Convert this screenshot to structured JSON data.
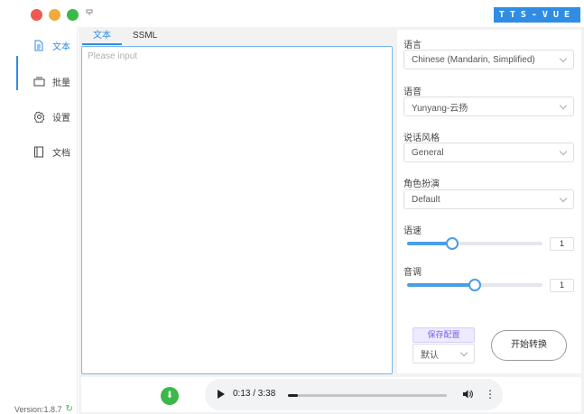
{
  "window": {
    "brand": "TTS-VUE"
  },
  "sidebar": {
    "items": [
      {
        "label": "文本",
        "icon": "document-icon",
        "active": true
      },
      {
        "label": "批量",
        "icon": "stack-icon",
        "active": false
      },
      {
        "label": "设置",
        "icon": "gear-icon",
        "active": false
      },
      {
        "label": "文档",
        "icon": "book-icon",
        "active": false
      }
    ],
    "version": "Version:1.8.7"
  },
  "editor": {
    "tabs": [
      {
        "label": "文本",
        "active": true
      },
      {
        "label": "SSML",
        "active": false
      }
    ],
    "placeholder": "Please input",
    "value": ""
  },
  "settings": {
    "language_label": "语言",
    "language_value": "Chinese (Mandarin, Simplified)",
    "voice_label": "语音",
    "voice_value": "Yunyang-云扬",
    "style_label": "说话风格",
    "style_value": "General",
    "role_label": "角色扮演",
    "role_value": "Default",
    "speed_label": "语速",
    "speed_value": "1",
    "speed_fraction": 0.33,
    "pitch_label": "音调",
    "pitch_value": "1",
    "pitch_fraction": 0.5,
    "save_label": "保存配置",
    "preset_value": "默认",
    "convert_label": "开始转换"
  },
  "player": {
    "download_glyph": "⬇",
    "time": "0:13 / 3:38",
    "progress_fraction": 0.06
  },
  "colors": {
    "accent": "#2f8de4",
    "success": "#3bb84a",
    "save": "#7a60e8"
  }
}
